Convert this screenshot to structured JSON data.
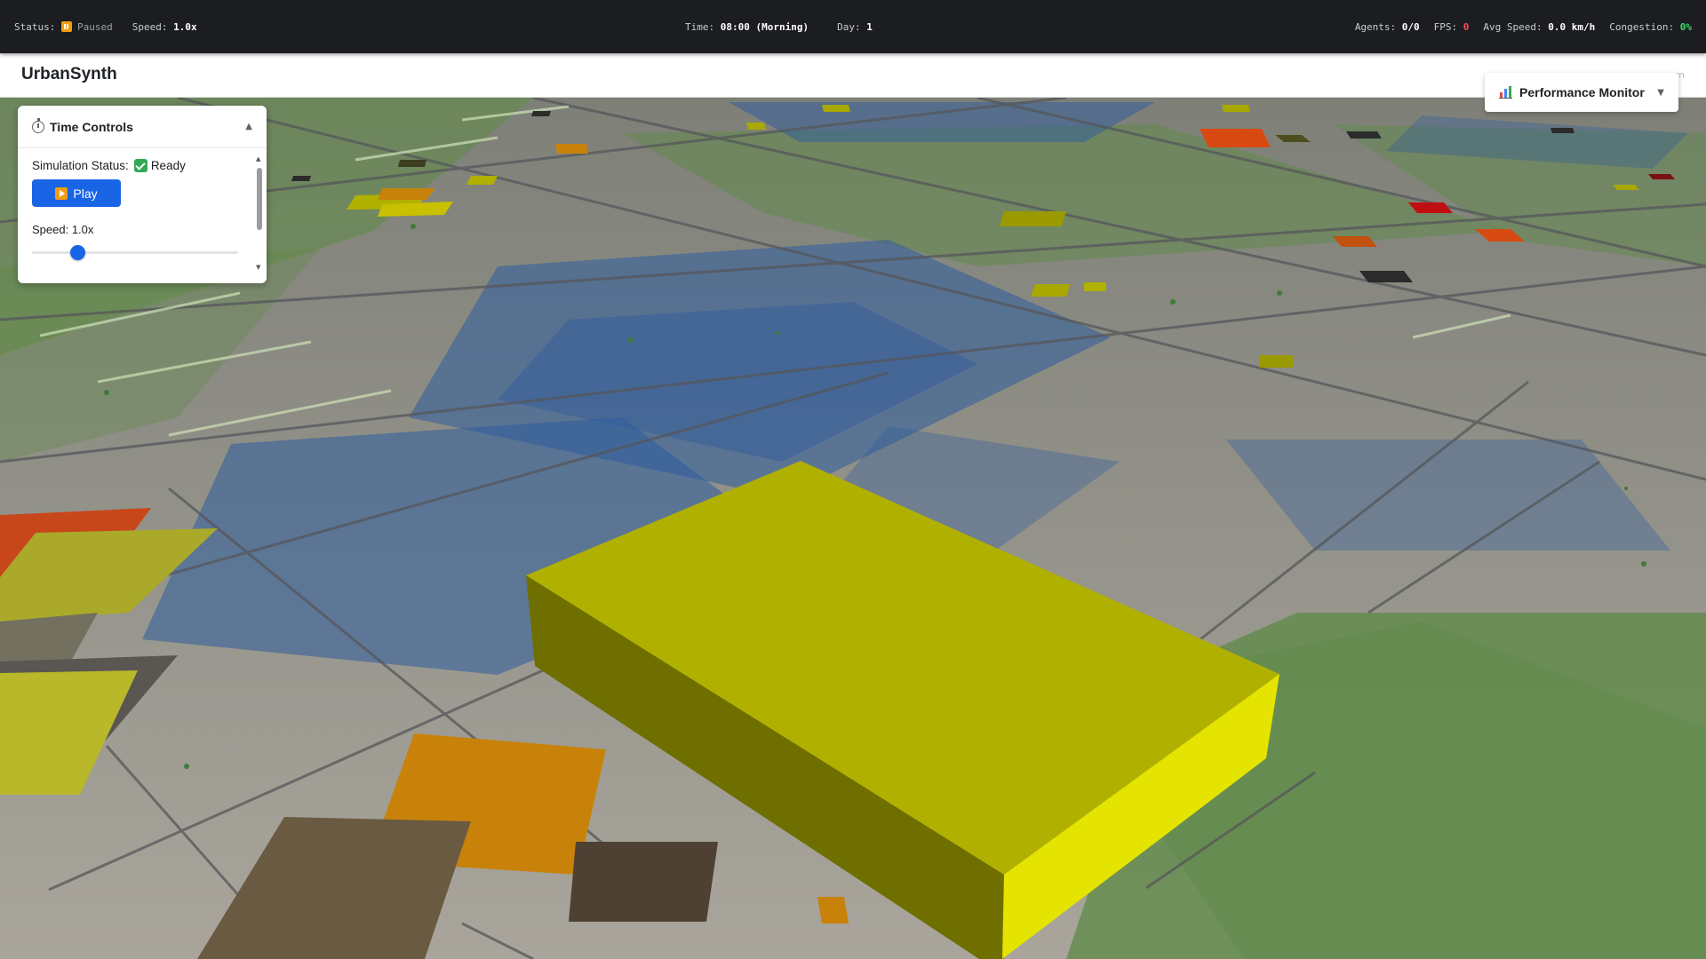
{
  "statusbar": {
    "status_label": "Status:",
    "status_value": "Paused",
    "speed_label": "Speed:",
    "speed_value": "1.0x",
    "time_label": "Time:",
    "time_value": "08:00 (Morning)",
    "day_label": "Day:",
    "day_value": "1",
    "agents_label": "Agents:",
    "agents_value": "0/0",
    "fps_label": "FPS:",
    "fps_value": "0",
    "avg_speed_label": "Avg Speed:",
    "avg_speed_value": "0.0 km/h",
    "congestion_label": "Congestion:",
    "congestion_value": "0%"
  },
  "app": {
    "title": "UrbanSynth",
    "faint_text": "m"
  },
  "time_controls": {
    "title": "Time Controls",
    "status_label": "Simulation Status:",
    "status_value": "Ready",
    "play_label": "Play",
    "speed_label": "Speed: 1.0x",
    "speed_slider_fraction": 0.2
  },
  "performance_monitor": {
    "label": "Performance Monitor"
  },
  "colors": {
    "accent": "#1a65e6",
    "paused": "#f29d12",
    "fps": "#ff4d4d",
    "congestion": "#3ddc6a",
    "building_top": "#b0b000",
    "building_front": "#6f6f00",
    "building_side": "#e4e400",
    "water": "#2e5c9e",
    "park": "#5e8a46",
    "ground": "#8d8c84"
  },
  "icons": {
    "pause": "pause-icon",
    "stopwatch": "stopwatch-icon",
    "check": "check-icon",
    "play": "play-icon",
    "chart": "chart-icon",
    "collapse": "chevron-up-icon",
    "dropdown": "chevron-down-icon"
  }
}
